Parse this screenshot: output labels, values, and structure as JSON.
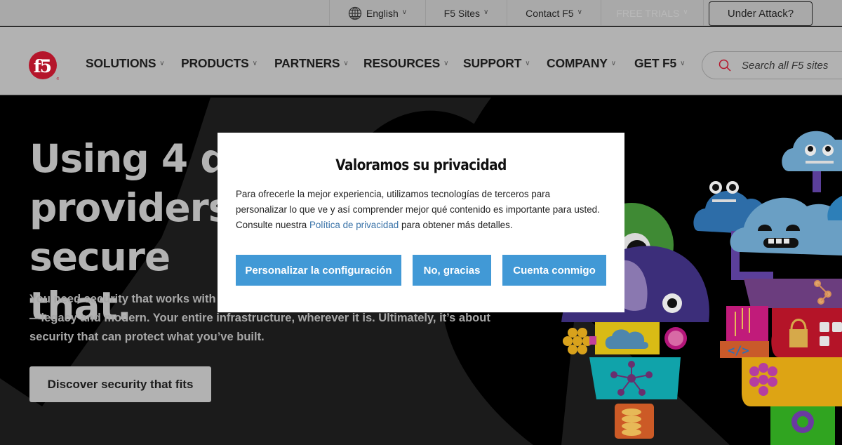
{
  "utility_bar": {
    "language": "English",
    "f5_sites": "F5 Sites",
    "contact": "Contact F5",
    "free_trials": "FREE TRIALS",
    "under_attack": "Under Attack?"
  },
  "nav": {
    "logo_alt": "f5",
    "items": [
      {
        "label": "SOLUTIONS"
      },
      {
        "label": "PRODUCTS"
      },
      {
        "label": "PARTNERS"
      },
      {
        "label": "RESOURCES"
      },
      {
        "label": "SUPPORT"
      },
      {
        "label": "COMPANY"
      },
      {
        "label": "GET F5"
      }
    ],
    "search_placeholder": "Search all F5 sites"
  },
  "hero": {
    "title_lines": [
      "Using 4 different cloud",
      "providers? We can secure",
      "that."
    ],
    "body": "You need security that works with everything you run. Every app, API, and architecture—legacy and modern. Your entire infrastructure, wherever it is. Ultimately, it’s about security that can protect what you’ve built.",
    "cta": "Discover security that fits"
  },
  "cookie_modal": {
    "title": "Valoramos su privacidad",
    "body_before_link": "Para ofrecerle la mejor experiencia, utilizamos tecnologías de terceros para personalizar lo que ve y así comprender mejor qué contenido es importante para usted. Consulte nuestra ",
    "link_text": "Política de privacidad",
    "body_after_link": " para obtener más detalles.",
    "buttons": {
      "customize": "Personalizar la configuración",
      "decline": "No, gracias",
      "accept": "Cuenta conmigo"
    }
  },
  "colors": {
    "brand_red": "#b5162b",
    "modal_button": "#4199d6",
    "link": "#3a73a8"
  }
}
